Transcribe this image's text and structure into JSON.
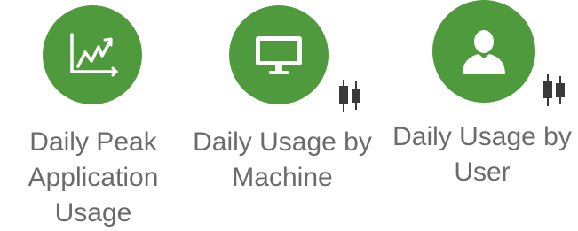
{
  "colors": {
    "circle_green": "#4f9a3c",
    "icon_white": "#ffffff",
    "label_gray": "#6b6b6b",
    "badge_dark": "#3a3a3a"
  },
  "tiles": [
    {
      "icon": "line-chart-icon",
      "label_lines": [
        "Daily Peak",
        "Application",
        "Usage"
      ],
      "badge": null
    },
    {
      "icon": "monitor-icon",
      "label_lines": [
        "Daily Usage by",
        "Machine"
      ],
      "badge": "candlestick-icon"
    },
    {
      "icon": "user-icon",
      "label_lines": [
        "Daily Usage by",
        "User"
      ],
      "badge": "candlestick-icon"
    }
  ]
}
